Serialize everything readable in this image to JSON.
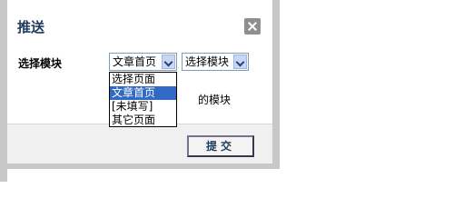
{
  "dialog": {
    "title": "推送",
    "close_label": "×"
  },
  "form": {
    "module_label": "选择模块",
    "select_page_value": "文章首页",
    "select_module_value": "选择模块",
    "hint_text": "的模块"
  },
  "dropdown": {
    "options": [
      "选择页面",
      "文章首页",
      "[未填写]",
      "其它页面"
    ],
    "selected_index": 1
  },
  "footer": {
    "submit_label": "提交"
  },
  "colors": {
    "title": "#1f3b5c",
    "selected_option_bg": "#316ac5",
    "footer_bg": "#f0f0f0"
  }
}
